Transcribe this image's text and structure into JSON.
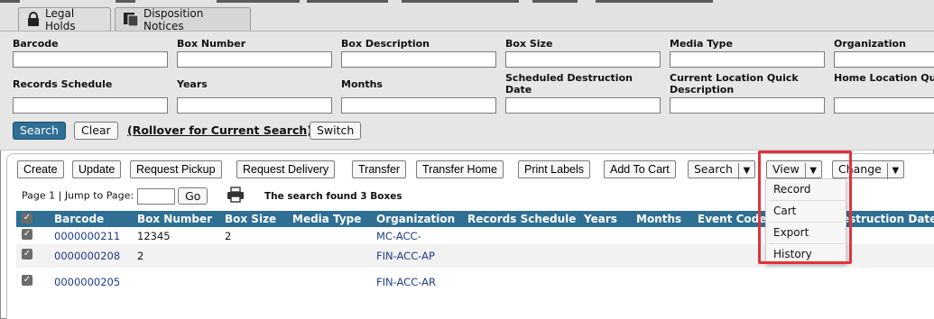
{
  "tabs": [
    {
      "label": "Legal Holds",
      "icon": "lock-icon"
    },
    {
      "label": "Disposition Notices",
      "icon": "document-icon"
    }
  ],
  "search_fields": {
    "row1": [
      "Barcode",
      "Box Number",
      "Box Description",
      "Box Size",
      "Media Type",
      "Organization"
    ],
    "row2": [
      "Records Schedule",
      "Years",
      "Months",
      "Scheduled Destruction Date",
      "Current Location Quick Description",
      "Home Location Quick Description"
    ]
  },
  "search_actions": {
    "search": "Search",
    "clear": "Clear",
    "rollover": "(Rollover for Current Search)",
    "switch": "Switch"
  },
  "toolbar": {
    "create": "Create",
    "update": "Update",
    "request_pickup": "Request Pickup",
    "request_delivery": "Request Delivery",
    "transfer": "Transfer",
    "transfer_home": "Transfer Home",
    "print_labels": "Print Labels",
    "add_to_cart": "Add To Cart",
    "search": "Search",
    "view": "View",
    "change": "Change"
  },
  "pager": {
    "page_text": "Page 1 | Jump to Page:",
    "jump_value": "",
    "go": "Go",
    "found_text": "The search found  3 Boxes"
  },
  "table": {
    "columns": [
      "Barcode",
      "Box Number",
      "Box Size",
      "Media Type",
      "Organization",
      "Records Schedule",
      "Years",
      "Months",
      "Event Code",
      "Destruction Date"
    ],
    "rows": [
      {
        "barcode": "0000000211",
        "box_number": "12345",
        "box_size": "2",
        "organization": "MC-ACC-"
      },
      {
        "barcode": "0000000208",
        "box_number": "2",
        "box_size": "",
        "organization": "FIN-ACC-AP"
      },
      {
        "barcode": "0000000205",
        "box_number": "",
        "box_size": "",
        "organization": "FIN-ACC-AR"
      }
    ]
  },
  "view_menu": [
    "Record",
    "Cart",
    "Export",
    "History"
  ],
  "colors": {
    "accent": "#2e6f93",
    "link": "#1f3c8a",
    "highlight": "#e0333d"
  }
}
